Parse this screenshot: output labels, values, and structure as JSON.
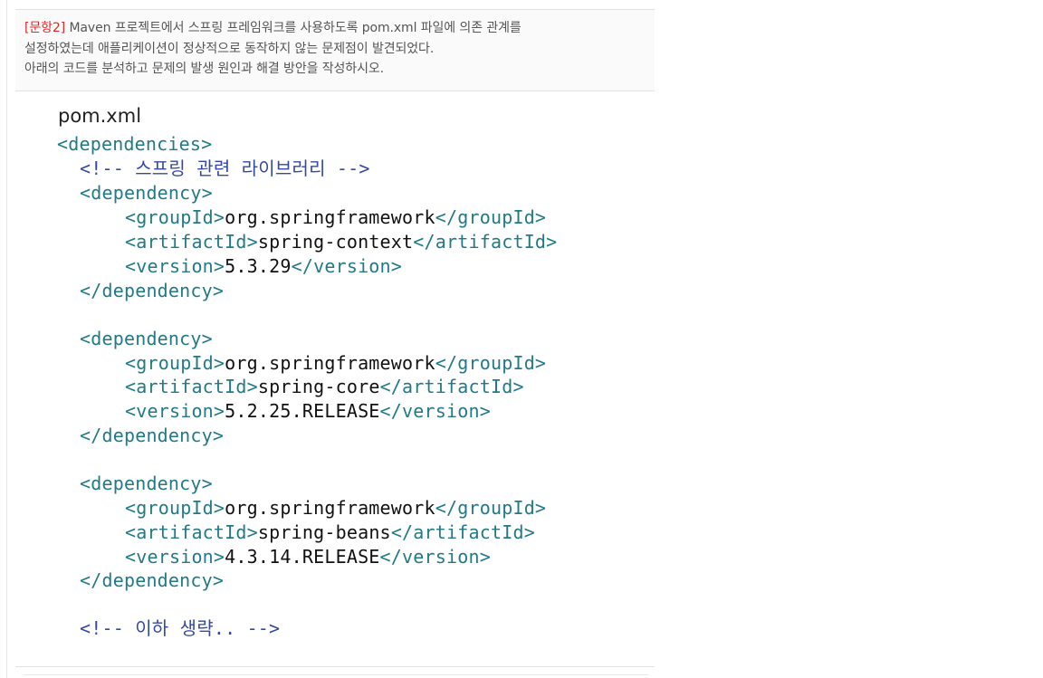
{
  "question": {
    "label": "[문항2]",
    "line1": "Maven 프로젝트에서 스프링 프레임워크를 사용하도록 pom.xml 파일에 의존 관계를",
    "line2": "설정하였는데 애플리케이션이 정상적으로 동작하지 않는 문제점이 발견되었다.",
    "line3": "아래의 코드를 분석하고 문제의 발생 원인과 해결 방안을 작성하시오."
  },
  "code": {
    "title": "pom.xml",
    "dependencies_open": "<dependencies>",
    "comment_spring": "<!-- 스프링 관련 라이브러리 -->",
    "dependency_open": "<dependency>",
    "dependency_close": "</dependency>",
    "groupId_open": "<groupId>",
    "groupId_close": "</groupId>",
    "artifactId_open": "<artifactId>",
    "artifactId_close": "</artifactId>",
    "version_open": "<version>",
    "version_close": "</version>",
    "dependencies": [
      {
        "groupId": "org.springframework",
        "artifactId": "spring-context",
        "version": "5.3.29"
      },
      {
        "groupId": "org.springframework",
        "artifactId": "spring-core",
        "version": "5.2.25.RELEASE"
      },
      {
        "groupId": "org.springframework",
        "artifactId": "spring-beans",
        "version": "4.3.14.RELEASE"
      }
    ],
    "comment_rest": "<!-- 이하 생략.. -->"
  },
  "colors": {
    "label": "#d82c2c",
    "tag": "#217a86",
    "comment": "#3548a6",
    "text": "#111111"
  }
}
